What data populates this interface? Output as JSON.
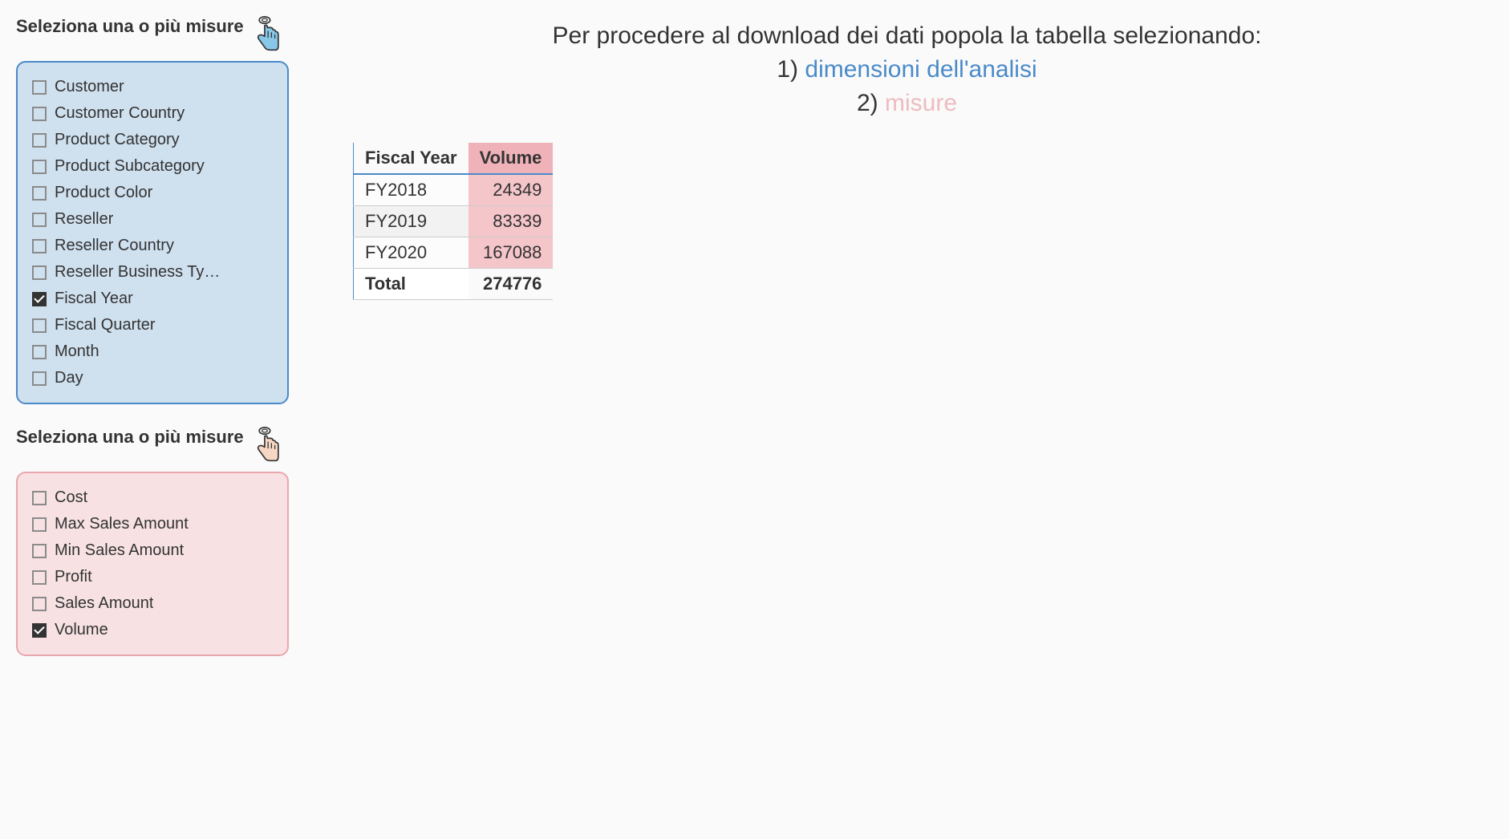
{
  "dimensions_panel": {
    "title": "Seleziona una o più misure",
    "items": [
      {
        "label": "Customer",
        "checked": false
      },
      {
        "label": "Customer Country",
        "checked": false
      },
      {
        "label": "Product Category",
        "checked": false
      },
      {
        "label": "Product Subcategory",
        "checked": false
      },
      {
        "label": "Product Color",
        "checked": false
      },
      {
        "label": "Reseller",
        "checked": false
      },
      {
        "label": "Reseller Country",
        "checked": false
      },
      {
        "label": "Reseller Business Ty…",
        "checked": false
      },
      {
        "label": "Fiscal Year",
        "checked": true
      },
      {
        "label": "Fiscal Quarter",
        "checked": false
      },
      {
        "label": "Month",
        "checked": false
      },
      {
        "label": "Day",
        "checked": false
      }
    ]
  },
  "measures_panel": {
    "title": "Seleziona una o più misure",
    "items": [
      {
        "label": "Cost",
        "checked": false
      },
      {
        "label": "Max Sales Amount",
        "checked": false
      },
      {
        "label": "Min Sales Amount",
        "checked": false
      },
      {
        "label": "Profit",
        "checked": false
      },
      {
        "label": "Sales Amount",
        "checked": false
      },
      {
        "label": "Volume",
        "checked": true
      }
    ]
  },
  "instructions": {
    "line1": "Per procedere al download dei dati popola la tabella selezionando:",
    "line2_prefix": "1) ",
    "line2_link": "dimensioni dell'analisi",
    "line3_prefix": "2) ",
    "line3_link": "misure"
  },
  "table": {
    "columns": [
      "Fiscal Year",
      "Volume"
    ],
    "rows": [
      {
        "label": "FY2018",
        "value": "24349"
      },
      {
        "label": "FY2019",
        "value": "83339"
      },
      {
        "label": "FY2020",
        "value": "167088"
      }
    ],
    "total": {
      "label": "Total",
      "value": "274776"
    }
  },
  "colors": {
    "blue": "#4a8ac9",
    "pink": "#efb2b8"
  },
  "chart_data": {
    "type": "table",
    "columns": [
      "Fiscal Year",
      "Volume"
    ],
    "rows": [
      [
        "FY2018",
        24349
      ],
      [
        "FY2019",
        83339
      ],
      [
        "FY2020",
        167088
      ]
    ],
    "total": [
      "Total",
      274776
    ]
  }
}
